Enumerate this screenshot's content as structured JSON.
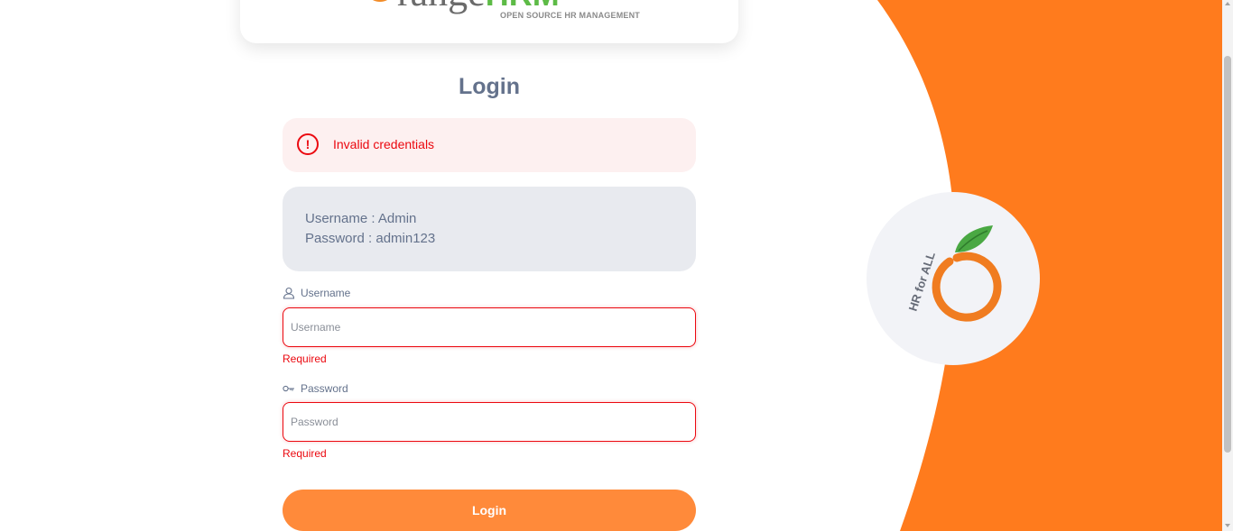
{
  "logo": {
    "word_rest": "range",
    "word_hrm": "HRM",
    "subtitle": "OPEN SOURCE HR MANAGEMENT"
  },
  "login": {
    "title": "Login",
    "error": "Invalid credentials",
    "credentials": {
      "username_line": "Username : Admin",
      "password_line": "Password : admin123"
    },
    "username": {
      "label": "Username",
      "placeholder": "Username",
      "value": "",
      "error": "Required"
    },
    "password": {
      "label": "Password",
      "placeholder": "Password",
      "value": "",
      "error": "Required"
    },
    "submit_label": "Login"
  },
  "branding": {
    "badge_text": "HR for ALL"
  },
  "colors": {
    "brand_orange": "#ff7b1d",
    "button_orange": "#ff8a3a",
    "error_red": "#eb0910",
    "text_slate": "#64728c",
    "badge_bg": "#f2f3f7"
  },
  "icons": {
    "alert": "exclamation-circle-icon",
    "username": "person-icon",
    "password": "key-icon"
  }
}
